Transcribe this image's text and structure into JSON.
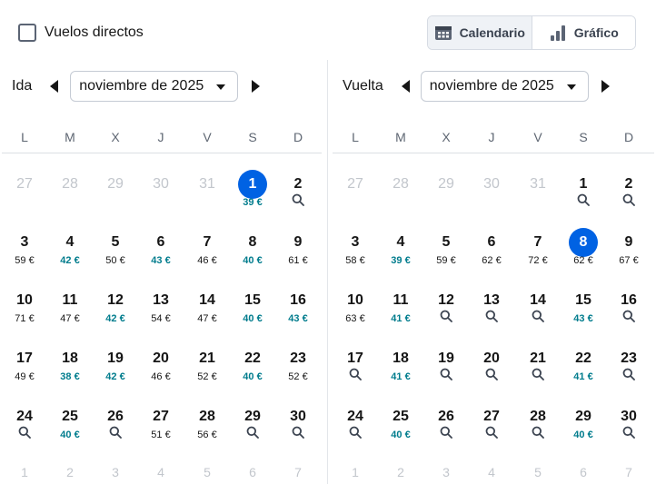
{
  "filters": {
    "direct_label": "Vuelos directos",
    "direct_checked": false
  },
  "view_toggle": {
    "calendar": "Calendario",
    "graph": "Gráfico",
    "active": "calendar"
  },
  "colors": {
    "accent": "#0062e3",
    "cheap": "#007c8d",
    "muted": "#c2c6cc",
    "text": "#161616"
  },
  "weekdays": [
    "L",
    "M",
    "X",
    "J",
    "V",
    "S",
    "D"
  ],
  "outbound": {
    "label": "Ida",
    "month": "noviembre de 2025",
    "selected_day": "1",
    "weeks": [
      [
        {
          "d": "27",
          "g": true
        },
        {
          "d": "28",
          "g": true
        },
        {
          "d": "29",
          "g": true
        },
        {
          "d": "30",
          "g": true
        },
        {
          "d": "31",
          "g": true
        },
        {
          "d": "1",
          "p": "39 €",
          "c": true,
          "sel": true
        },
        {
          "d": "2",
          "s": true
        }
      ],
      [
        {
          "d": "3",
          "p": "59 €"
        },
        {
          "d": "4",
          "p": "42 €",
          "c": true
        },
        {
          "d": "5",
          "p": "50 €"
        },
        {
          "d": "6",
          "p": "43 €",
          "c": true
        },
        {
          "d": "7",
          "p": "46 €"
        },
        {
          "d": "8",
          "p": "40 €",
          "c": true
        },
        {
          "d": "9",
          "p": "61 €"
        }
      ],
      [
        {
          "d": "10",
          "p": "71 €"
        },
        {
          "d": "11",
          "p": "47 €"
        },
        {
          "d": "12",
          "p": "42 €",
          "c": true
        },
        {
          "d": "13",
          "p": "54 €"
        },
        {
          "d": "14",
          "p": "47 €"
        },
        {
          "d": "15",
          "p": "40 €",
          "c": true
        },
        {
          "d": "16",
          "p": "43 €",
          "c": true
        }
      ],
      [
        {
          "d": "17",
          "p": "49 €"
        },
        {
          "d": "18",
          "p": "38 €",
          "c": true
        },
        {
          "d": "19",
          "p": "42 €",
          "c": true
        },
        {
          "d": "20",
          "p": "46 €"
        },
        {
          "d": "21",
          "p": "52 €"
        },
        {
          "d": "22",
          "p": "40 €",
          "c": true
        },
        {
          "d": "23",
          "p": "52 €"
        }
      ],
      [
        {
          "d": "24",
          "s": true
        },
        {
          "d": "25",
          "p": "40 €",
          "c": true
        },
        {
          "d": "26",
          "s": true
        },
        {
          "d": "27",
          "p": "51 €"
        },
        {
          "d": "28",
          "p": "56 €"
        },
        {
          "d": "29",
          "s": true
        },
        {
          "d": "30",
          "s": true
        }
      ]
    ],
    "trailing": [
      "1",
      "2",
      "3",
      "4",
      "5",
      "6",
      "7"
    ]
  },
  "return": {
    "label": "Vuelta",
    "month": "noviembre de 2025",
    "selected_day": "8",
    "weeks": [
      [
        {
          "d": "27",
          "g": true
        },
        {
          "d": "28",
          "g": true
        },
        {
          "d": "29",
          "g": true
        },
        {
          "d": "30",
          "g": true
        },
        {
          "d": "31",
          "g": true
        },
        {
          "d": "1",
          "s": true
        },
        {
          "d": "2",
          "s": true
        }
      ],
      [
        {
          "d": "3",
          "p": "58 €"
        },
        {
          "d": "4",
          "p": "39 €",
          "c": true
        },
        {
          "d": "5",
          "p": "59 €"
        },
        {
          "d": "6",
          "p": "62 €"
        },
        {
          "d": "7",
          "p": "72 €"
        },
        {
          "d": "8",
          "p": "62 €",
          "sel": true
        },
        {
          "d": "9",
          "p": "67 €"
        }
      ],
      [
        {
          "d": "10",
          "p": "63 €"
        },
        {
          "d": "11",
          "p": "41 €",
          "c": true
        },
        {
          "d": "12",
          "s": true
        },
        {
          "d": "13",
          "s": true
        },
        {
          "d": "14",
          "s": true
        },
        {
          "d": "15",
          "p": "43 €",
          "c": true
        },
        {
          "d": "16",
          "s": true
        }
      ],
      [
        {
          "d": "17",
          "s": true
        },
        {
          "d": "18",
          "p": "41 €",
          "c": true
        },
        {
          "d": "19",
          "s": true
        },
        {
          "d": "20",
          "s": true
        },
        {
          "d": "21",
          "s": true
        },
        {
          "d": "22",
          "p": "41 €",
          "c": true
        },
        {
          "d": "23",
          "s": true
        }
      ],
      [
        {
          "d": "24",
          "s": true
        },
        {
          "d": "25",
          "p": "40 €",
          "c": true
        },
        {
          "d": "26",
          "s": true
        },
        {
          "d": "27",
          "s": true
        },
        {
          "d": "28",
          "s": true
        },
        {
          "d": "29",
          "p": "40 €",
          "c": true
        },
        {
          "d": "30",
          "s": true
        }
      ]
    ],
    "trailing": [
      "1",
      "2",
      "3",
      "4",
      "5",
      "6",
      "7"
    ]
  }
}
